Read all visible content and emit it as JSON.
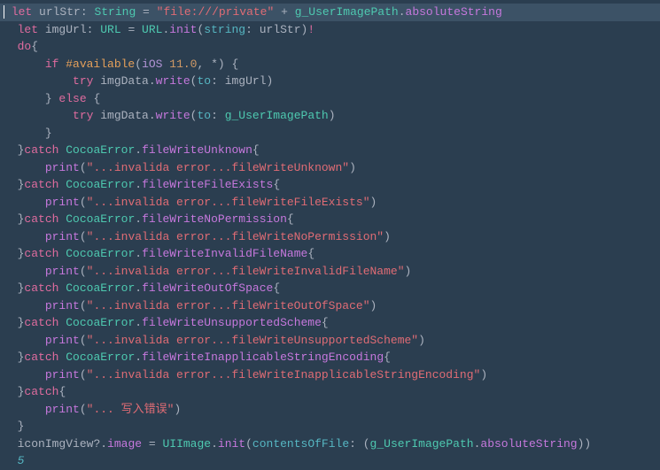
{
  "line1": {
    "let": "let",
    "urlStr": " urlStr",
    "colon": ": ",
    "String": "String",
    "eq": " = ",
    "lit": "\"file:///private\"",
    "plus": " + ",
    "gUser": "g_UserImagePath",
    "dot": ".",
    "absStr": "absoluteString"
  },
  "line2": {
    "let": "let",
    "imgUrl": " imgUrl",
    "colon": ": ",
    "URL": "URL",
    "eq": " = ",
    "URL2": "URL",
    "dot": ".",
    "init": "init",
    "open": "(",
    "param": "string",
    "colon2": ": urlStr)",
    "bang": "!"
  },
  "line3": {
    "do": "do",
    "brace": "{"
  },
  "line4": {
    "if": "if",
    "hash": " #available",
    "open": "(",
    "ios": "iOS",
    "ver": " 11.0",
    "comma": ", *) {"
  },
  "line5": {
    "try": "try",
    "imgData": " imgData",
    "dot": ".",
    "write": "write",
    "open": "(",
    "to": "to",
    "arg": ": imgUrl)"
  },
  "line6": {
    "close": "} ",
    "else": "else",
    "brace": " {"
  },
  "line7": {
    "try": "try",
    "imgData": " imgData",
    "dot": ".",
    "write": "write",
    "open": "(",
    "to": "to",
    "colon": ": ",
    "gUser": "g_UserImagePath",
    "close": ")"
  },
  "line8": {
    "brace": "}"
  },
  "catchBlocks": [
    {
      "catch": "catch",
      "err": "CocoaError",
      "dot": ".",
      "caseName": "fileWriteUnknown",
      "msg": "\"...invalida error...fileWriteUnknown\""
    },
    {
      "catch": "catch",
      "err": "CocoaError",
      "dot": ".",
      "caseName": "fileWriteFileExists",
      "msg": "\"...invalida error...fileWriteFileExists\""
    },
    {
      "catch": "catch",
      "err": "CocoaError",
      "dot": ".",
      "caseName": "fileWriteNoPermission",
      "msg": "\"...invalida error...fileWriteNoPermission\""
    },
    {
      "catch": "catch",
      "err": "CocoaError",
      "dot": ".",
      "caseName": "fileWriteInvalidFileName",
      "msg": "\"...invalida error...fileWriteInvalidFileName\""
    },
    {
      "catch": "catch",
      "err": "CocoaError",
      "dot": ".",
      "caseName": "fileWriteOutOfSpace",
      "msg": "\"...invalida error...fileWriteOutOfSpace\""
    },
    {
      "catch": "catch",
      "err": "CocoaError",
      "dot": ".",
      "caseName": "fileWriteUnsupportedScheme",
      "msg": "\"...invalida error...fileWriteUnsupportedScheme\""
    },
    {
      "catch": "catch",
      "err": "CocoaError",
      "dot": ".",
      "caseName": "fileWriteInapplicableStringEncoding",
      "msg": "\"...invalida error...fileWriteInapplicableStringEncoding\""
    }
  ],
  "print": "print",
  "printOpen": "(",
  "printClose": ")",
  "closeBrace": "}",
  "closeCatch": "}catch ",
  "lastCatch": {
    "catch": "catch",
    "brace": "{",
    "msg": "\"... 写入错误\""
  },
  "lastBrace": "}",
  "lastLine": {
    "iconImgView": "iconImgView",
    "q": "?.",
    "image": "image",
    "eq": " = ",
    "UIImage": "UIImage",
    "dot": ".",
    "init": "init",
    "open": "(",
    "param": "contentsOfFile",
    "colon": ": (",
    "gUser": "g_UserImagePath",
    "dot2": ".",
    "absStr": "absoluteString",
    "close": "))"
  },
  "five": "5"
}
